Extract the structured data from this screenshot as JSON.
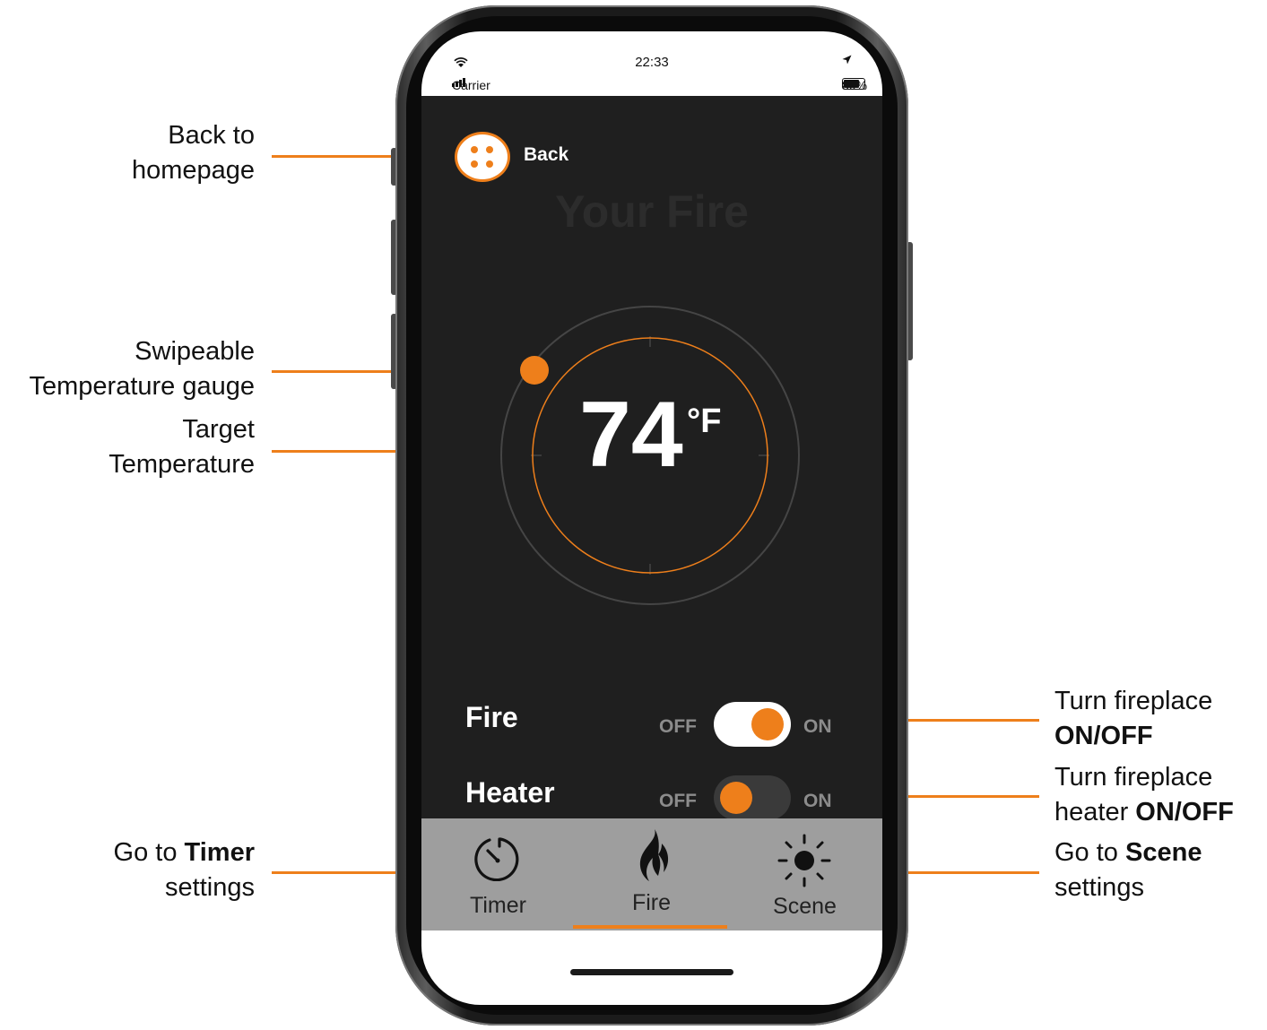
{
  "annotations": {
    "back": [
      "Back to",
      "homepage"
    ],
    "gauge": [
      "Swipeable",
      "Temperature gauge"
    ],
    "target": [
      "Target",
      "Temperature"
    ],
    "timer": {
      "prefix": "Go to ",
      "bold": "Timer",
      "line2": "settings"
    },
    "fire_toggle": {
      "line1": "Turn fireplace",
      "bold": "ON/OFF"
    },
    "heater_toggle": {
      "line1": "Turn fireplace",
      "prefix2": "heater ",
      "bold": "ON/OFF"
    },
    "scene": {
      "prefix": "Go to ",
      "bold": "Scene",
      "line2": "settings"
    }
  },
  "status_bar": {
    "carrier": "Carrier",
    "time": "22:33",
    "battery": "80%"
  },
  "header": {
    "back_label": "Back",
    "title": "Your Fire"
  },
  "gauge": {
    "value": "74",
    "unit": "°F"
  },
  "controls": {
    "fire": {
      "label": "Fire",
      "off": "OFF",
      "on": "ON",
      "state": "on"
    },
    "heater": {
      "label": "Heater",
      "off": "OFF",
      "on": "ON",
      "state": "off"
    }
  },
  "tabs": [
    {
      "label": "Timer",
      "icon": "timer-icon"
    },
    {
      "label": "Fire",
      "icon": "flame-icon",
      "active": true
    },
    {
      "label": "Scene",
      "icon": "sun-icon"
    }
  ],
  "colors": {
    "accent": "#ee7f1b",
    "screen_bg": "#1f1f1f",
    "tabbar_bg": "#9e9e9e"
  }
}
